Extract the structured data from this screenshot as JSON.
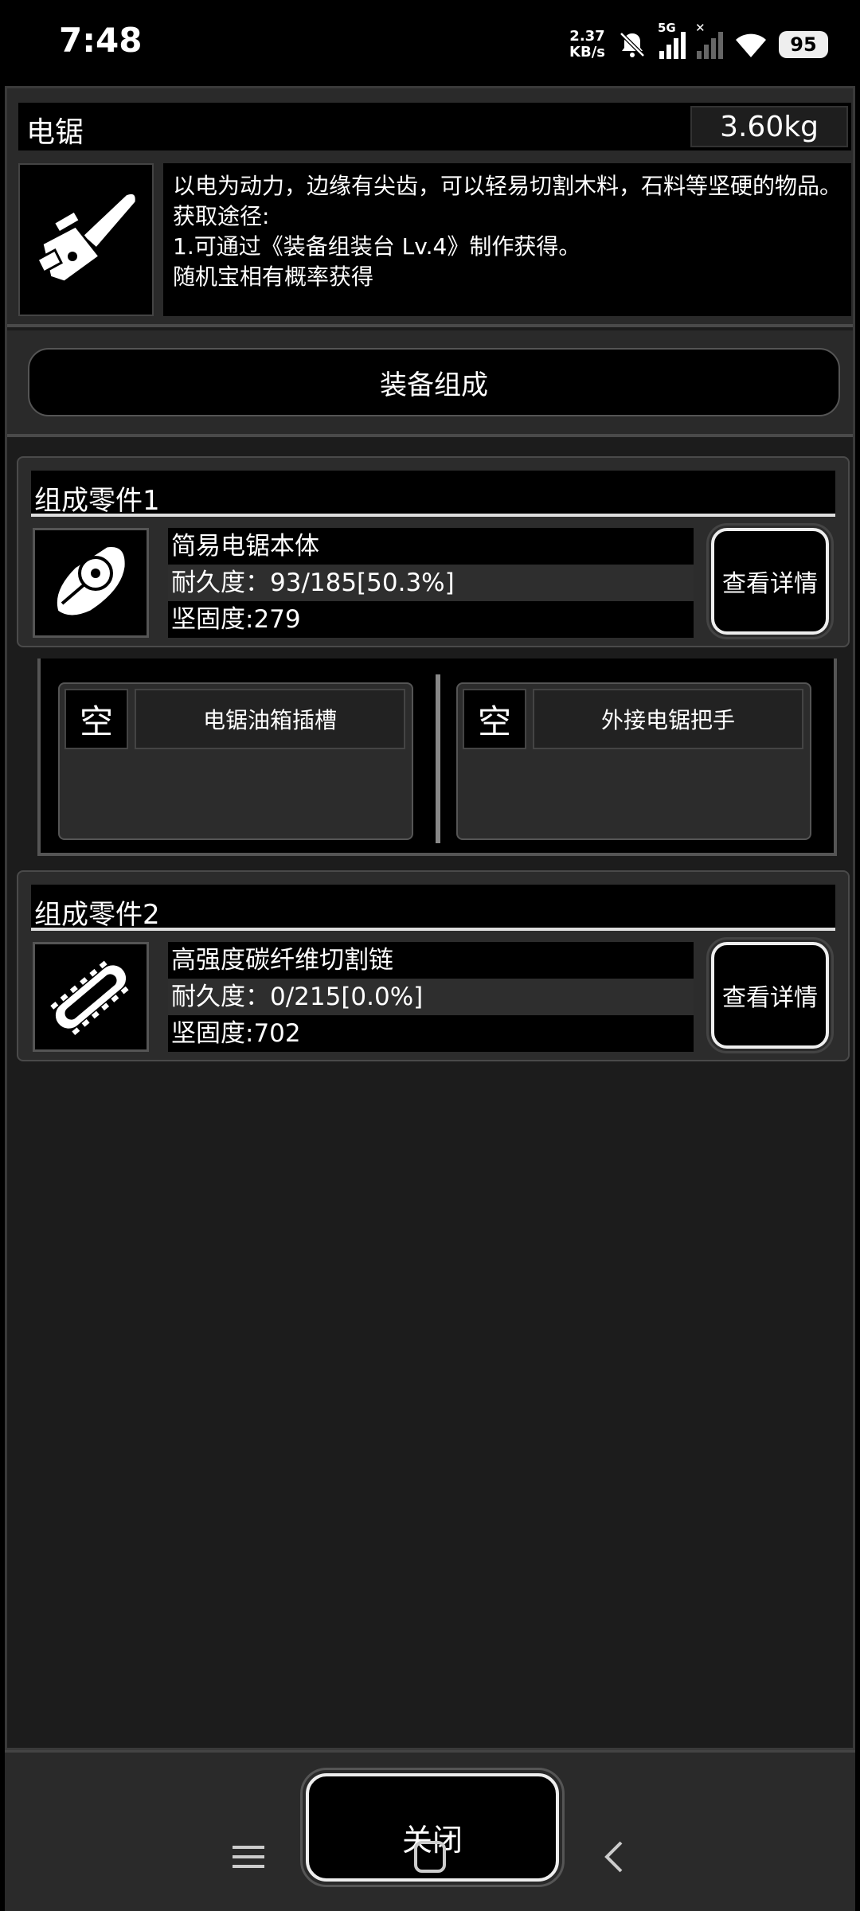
{
  "status_bar": {
    "time": "7:48",
    "net_speed_value": "2.37",
    "net_speed_unit": "KB/s",
    "network_type": "5G",
    "battery": "95"
  },
  "item": {
    "name": "电锯",
    "weight": "3.60kg",
    "icon": "chainsaw-icon",
    "description_lines": [
      "以电为动力，边缘有尖齿，可以轻易切割木料，石料等坚硬的物品。",
      "获取途径:",
      "1.可通过《装备组装台 Lv.4》制作获得。",
      "随机宝相有概率获得"
    ]
  },
  "section": {
    "label": "装备组成"
  },
  "parts": [
    {
      "title": "组成零件1",
      "name": "简易电锯本体",
      "durability": "耐久度：93/185[50.3%]",
      "hardness": "坚固度:279",
      "detail_label": "查看详情",
      "icon": "chainsaw-body-icon"
    },
    {
      "title": "组成零件2",
      "name": "高强度碳纤维切割链",
      "durability": "耐久度：0/215[0.0%]",
      "hardness": "坚固度:702",
      "detail_label": "查看详情",
      "icon": "cutting-chain-icon"
    }
  ],
  "slots": [
    {
      "state": "空",
      "name": "电锯油箱插槽"
    },
    {
      "state": "空",
      "name": "外接电锯把手"
    }
  ],
  "footer": {
    "close_label": "关闭"
  }
}
